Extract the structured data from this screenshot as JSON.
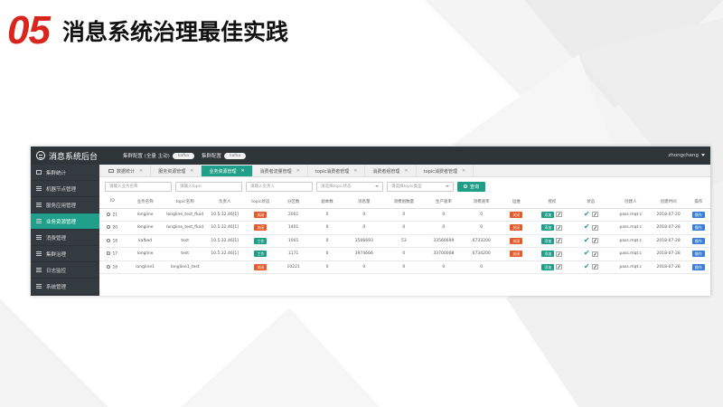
{
  "slide": {
    "number": "05",
    "title": "消息系统治理最佳实践"
  },
  "app": {
    "title": "消息系统后台",
    "env_label": "集群配置 (全量 主动)",
    "env_value_1": "kafka",
    "env_label_2": "集群配置",
    "env_value_2": "kafka",
    "user": "zhongcheng"
  },
  "sidebar": {
    "items": [
      {
        "label": "集群统计"
      },
      {
        "label": "机器节点管理"
      },
      {
        "label": "服务应用管理"
      },
      {
        "label": "业务资源管理"
      },
      {
        "label": "消费管理"
      },
      {
        "label": "集群治理"
      },
      {
        "label": "日志监控"
      },
      {
        "label": "系统管理"
      }
    ],
    "active_index": 3
  },
  "tabs": [
    {
      "label": "数据统计"
    },
    {
      "label": "服务资源管理"
    },
    {
      "label": "业务资源管理"
    },
    {
      "label": "消费者流量管理"
    },
    {
      "label": "topic消费者管理"
    },
    {
      "label": "消费者组管理"
    },
    {
      "label": "topic消费者管理"
    }
  ],
  "active_tab": 2,
  "filters": {
    "f1": "请输入业务名称",
    "f2": "请输入topic",
    "f3": "请输入负责人",
    "f4": "请选择topic状态",
    "f5": "请选择topic类型",
    "query_label": "查询"
  },
  "table": {
    "headers": [
      "ID",
      "业务名称",
      "topic名称",
      "负责人",
      "topic状态",
      "分区数",
      "副本数",
      "消息量",
      "消费组数量",
      "生产速率",
      "消费速率",
      "运维",
      "授权",
      "状态",
      "创建人",
      "创建时间",
      "操作"
    ],
    "rows": [
      {
        "id": "21",
        "biz": "longline",
        "topic": "longline_test_fluid",
        "owner": "10.5.32.46[1]",
        "status": "关闭",
        "status_color": "red",
        "partitions": "2001",
        "replicas": "0",
        "messages": "0",
        "groups": "0",
        "prod": "0",
        "cons": "0",
        "ops": "关闭",
        "ops_color": "red",
        "auth": "添加",
        "creator": "pass.mqt.c",
        "created": "2018-07-20",
        "op": "操作"
      },
      {
        "id": "20",
        "biz": "longline",
        "topic": "longline_test_fluid",
        "owner": "10.5.32.46[1]",
        "status": "关闭",
        "status_color": "red",
        "partitions": "1401",
        "replicas": "0",
        "messages": "0",
        "groups": "0",
        "prod": "0",
        "cons": "0",
        "ops": "关闭",
        "ops_color": "red",
        "auth": "添加",
        "creator": "pass.mqt.c",
        "created": "2018-07-28",
        "op": "操作"
      },
      {
        "id": "18",
        "biz": "kafked",
        "topic": "test",
        "owner": "10.5.32.46[1]",
        "status": "工作",
        "status_color": "green",
        "partitions": "1001",
        "replicas": "0",
        "messages": "3506693",
        "groups": "53",
        "prod": "33566699",
        "cons": "6733200",
        "ops": "关闭",
        "ops_color": "red",
        "auth": "添加",
        "creator": "pass.mqt.c",
        "created": "2018-07-28",
        "op": "操作"
      },
      {
        "id": "17",
        "biz": "longline",
        "topic": "test",
        "owner": "10.5.32.46[1]",
        "status": "工作",
        "status_color": "green",
        "partitions": "1171",
        "replicas": "0",
        "messages": "3974666",
        "groups": "0",
        "prod": "33700008",
        "cons": "6734200",
        "ops": "关闭",
        "ops_color": "red",
        "auth": "添加",
        "creator": "pass.mqt.c",
        "created": "2018-07-28",
        "op": "操作"
      },
      {
        "id": "16",
        "biz": "longline1",
        "topic": "longline1_test",
        "owner": "",
        "status": "关闭",
        "status_color": "red",
        "partitions": "10221",
        "replicas": "0",
        "messages": "0",
        "groups": "0",
        "prod": "0",
        "cons": "0",
        "ops": "",
        "ops_color": "",
        "auth": "添加",
        "creator": "pass.mqt.c",
        "created": "2018-07-28",
        "op": "操作"
      }
    ]
  }
}
